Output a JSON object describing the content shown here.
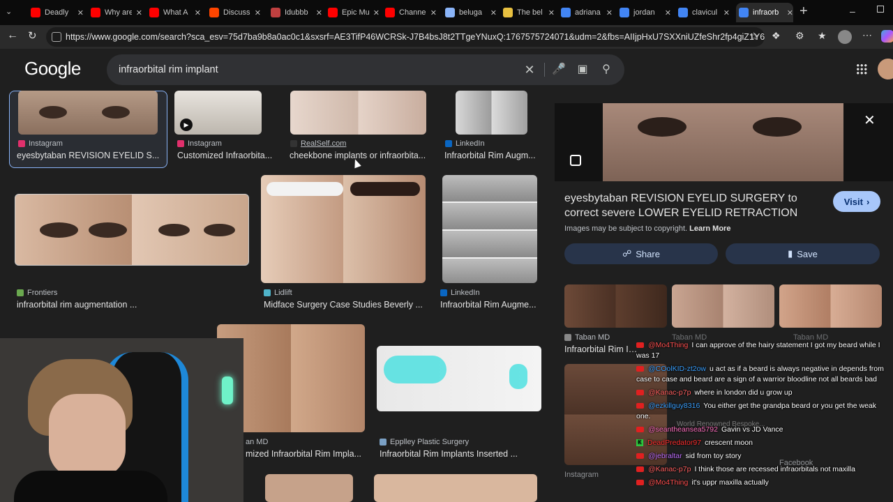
{
  "browser": {
    "tabs": [
      {
        "label": "Deadly",
        "color": "#ff0000"
      },
      {
        "label": "Why are",
        "color": "#ff0000"
      },
      {
        "label": "What A",
        "color": "#ff0000"
      },
      {
        "label": "Discussi",
        "color": "#ff4500"
      },
      {
        "label": "Idubbb",
        "color": "#c04040"
      },
      {
        "label": "Epic Mu",
        "color": "#ff0000"
      },
      {
        "label": "Channe",
        "color": "#ff0000"
      },
      {
        "label": "beluga",
        "color": "#8ab4f8"
      },
      {
        "label": "The bel",
        "color": "#e8c040"
      },
      {
        "label": "adriana",
        "color": "#4285f4"
      },
      {
        "label": "jordan",
        "color": "#4285f4"
      },
      {
        "label": "clavicul",
        "color": "#4285f4"
      },
      {
        "label": "infraorb",
        "color": "#4285f4"
      }
    ],
    "url": "https://www.google.com/search?sca_esv=75d7ba9b8a0ac0c1&sxsrf=AE3TifP46WCRSk-J7B4bsJ8t2TTgeYNuxQ:1767575724071&udm=2&fbs=AIIjpHxU7SXXniUZfeShr2fp4giZ1Y6MJ2..."
  },
  "google": {
    "logo": "Google",
    "query": "infraorbital rim implant"
  },
  "results": [
    {
      "source": "Instagram",
      "title": "eyesbytaban REVISION EYELID S...",
      "favcolor": "#e1306c"
    },
    {
      "source": "Instagram",
      "title": "Customized Infraorbita...",
      "favcolor": "#e1306c"
    },
    {
      "source": "RealSelf.com",
      "title": "cheekbone implants or infraorbita...",
      "favcolor": "#333333"
    },
    {
      "source": "LinkedIn",
      "title": "Infraorbital Rim Augm...",
      "favcolor": "#0a66c2"
    },
    {
      "source": "Frontiers",
      "title": "infraorbital rim augmentation ...",
      "favcolor": "#6aa84f"
    },
    {
      "source": "Lidlift",
      "title": "Midface Surgery Case Studies Beverly ...",
      "favcolor": "#4fb3c9"
    },
    {
      "source": "LinkedIn",
      "title": "Infraorbital Rim Augme...",
      "favcolor": "#0a66c2"
    },
    {
      "source": "an MD",
      "title": "mized Infraorbital Rim Impla...",
      "favcolor": "#888888"
    },
    {
      "source": "Epplley Plastic Surgery",
      "title": "Infraorbital Rim Implants Inserted ...",
      "favcolor": "#7aa0c4"
    }
  ],
  "panel": {
    "title": "eyesbytaban REVISION EYELID SURGERY to correct severe LOWER EYELID RETRACTION from botched...",
    "visit": "Visit",
    "copyright": "Images may be subject to copyright.",
    "learn_more": "Learn More",
    "share": "Share",
    "save": "Save",
    "related": [
      {
        "source": "Taban MD",
        "title": "Infraorbital Rim Impl"
      },
      {
        "source": "Taban MD",
        "title": ""
      },
      {
        "source": "Taban MD",
        "title": ""
      }
    ],
    "more_sources": [
      "Instagram",
      "Facebook"
    ],
    "faint_text": "World Renowned Bespoke..."
  },
  "chat": [
    {
      "platform": "yt",
      "user": "@Mo4Thing",
      "color": "#ff5050",
      "text": "I can approve of the hairy statement I got my beard while I was 17"
    },
    {
      "platform": "yt",
      "user": "@COolKID-zt2ow",
      "color": "#3aa0ff",
      "text": "u act as if a beard is always negative in depends from case to case and beard are a sign of a warrior bloodline not all beards bad"
    },
    {
      "platform": "yt",
      "user": "@Kanac-p7p",
      "color": "#ff6060",
      "text": "where in london did u grow up"
    },
    {
      "platform": "yt",
      "user": "@ezkillguy8316",
      "color": "#3aa0ff",
      "text": "You either get the grandpa beard or you get the weak one."
    },
    {
      "platform": "yt",
      "user": "@seantheansea5792",
      "color": "#ff70c0",
      "text": "Gavin vs JD Vance"
    },
    {
      "platform": "kick",
      "user": "DeadPredator97",
      "color": "#ff3030",
      "text": "crescent moon"
    },
    {
      "platform": "yt",
      "user": "@jebraltar",
      "color": "#c070ff",
      "text": "sid from toy story"
    },
    {
      "platform": "yt",
      "user": "@Kanac-p7p",
      "color": "#ff6060",
      "text": "I think those are recessed infraorbitals not maxilla"
    },
    {
      "platform": "yt",
      "user": "@Mo4Thing",
      "color": "#ff5050",
      "text": "it's uppr maxilla actually"
    }
  ]
}
